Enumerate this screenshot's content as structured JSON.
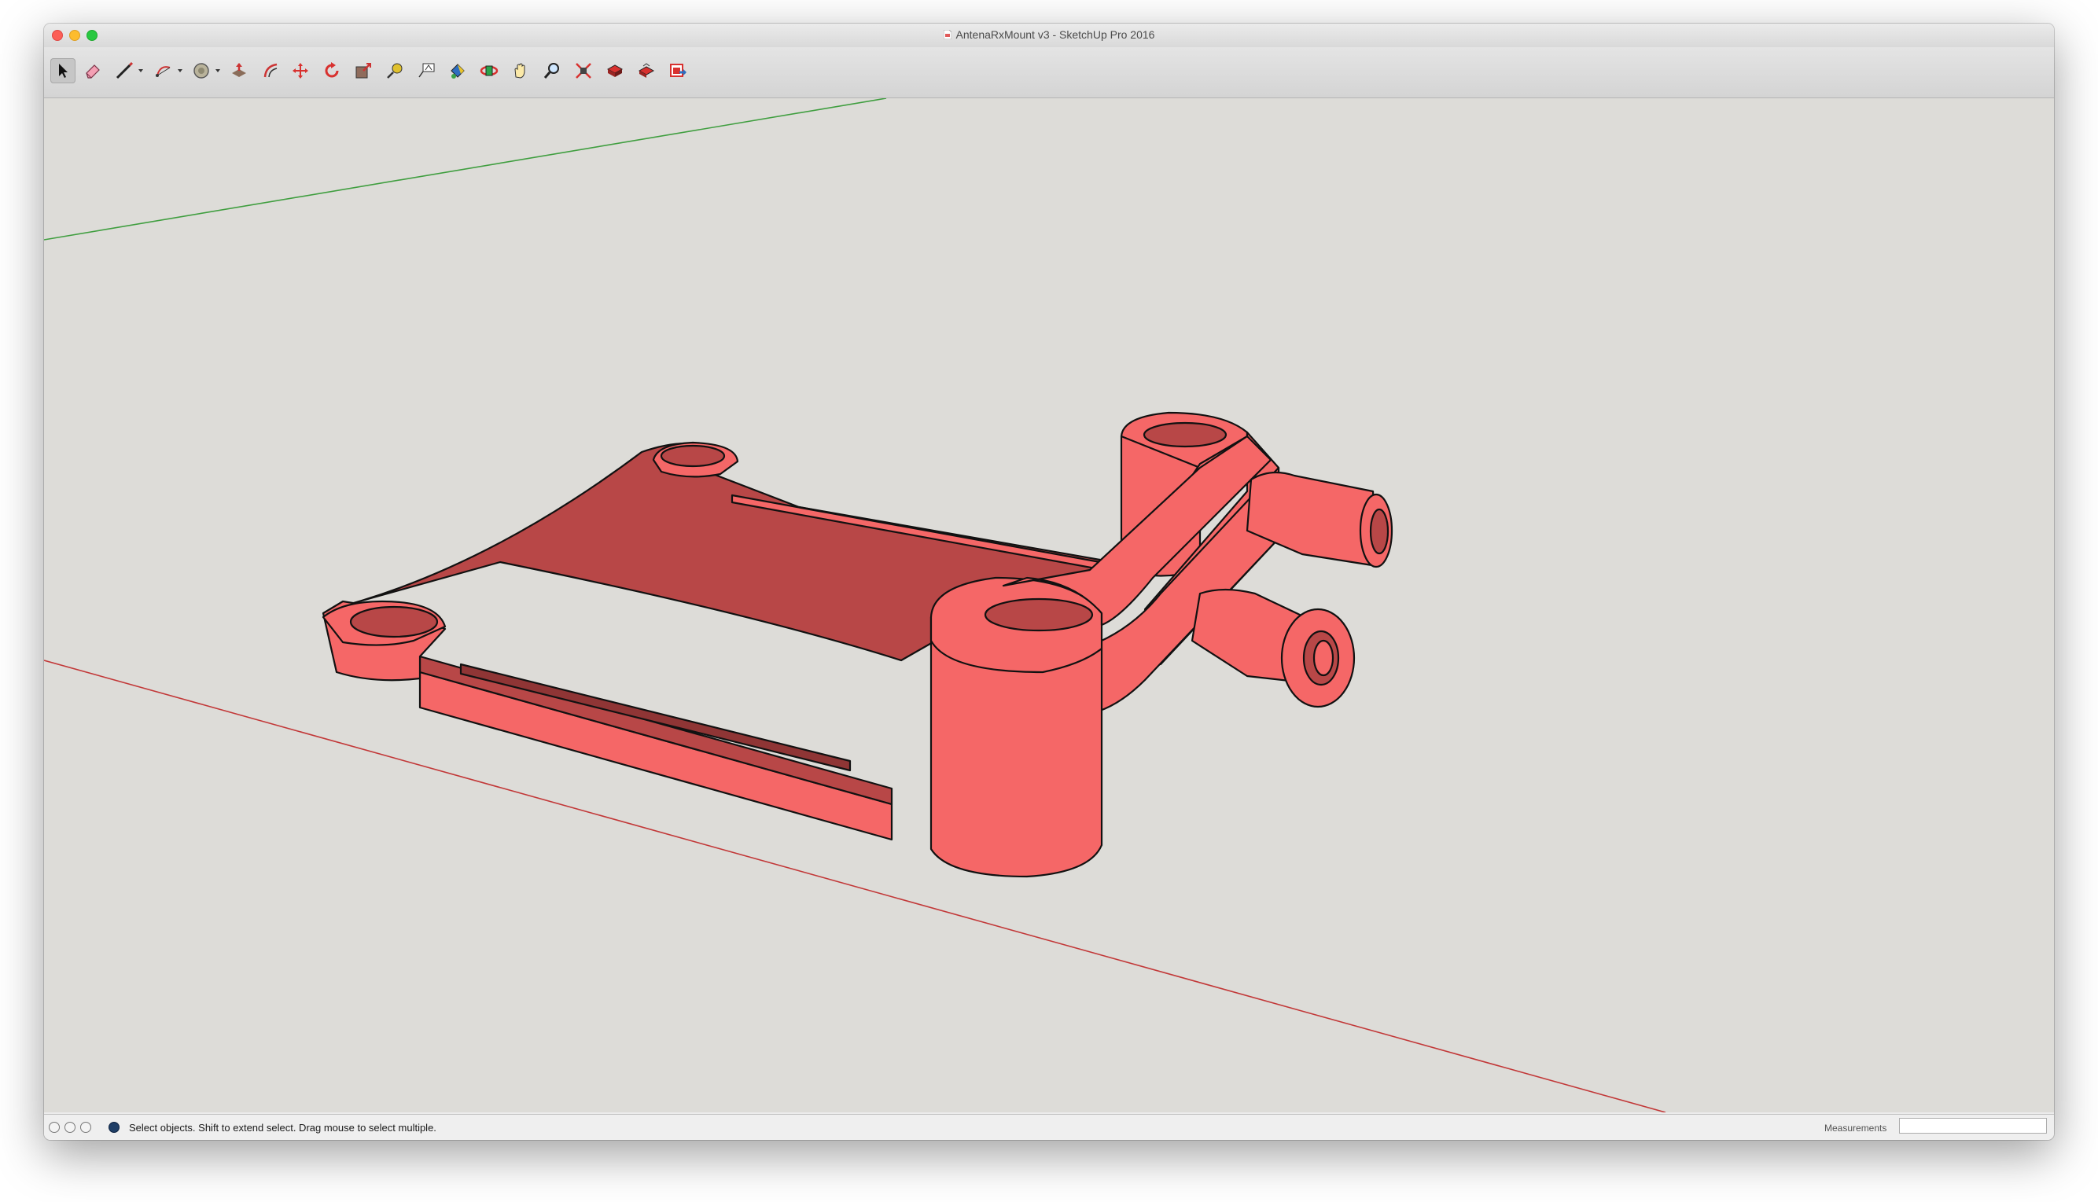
{
  "window": {
    "title": "AntenaRxMount v3 - SketchUp Pro 2016"
  },
  "toolbar": {
    "tools": [
      {
        "name": "select-tool-icon",
        "active": true
      },
      {
        "name": "eraser-tool-icon"
      },
      {
        "name": "line-tool-icon",
        "has_dropdown": true
      },
      {
        "name": "arc-tool-icon",
        "has_dropdown": true
      },
      {
        "name": "shape-tool-icon",
        "has_dropdown": true
      },
      {
        "name": "push-pull-tool-icon"
      },
      {
        "name": "offset-tool-icon"
      },
      {
        "name": "move-tool-icon"
      },
      {
        "name": "rotate-tool-icon"
      },
      {
        "name": "scale-tool-icon"
      },
      {
        "name": "tape-measure-tool-icon"
      },
      {
        "name": "text-tool-icon"
      },
      {
        "name": "paint-bucket-tool-icon"
      },
      {
        "name": "orbit-tool-icon"
      },
      {
        "name": "pan-tool-icon"
      },
      {
        "name": "zoom-tool-icon"
      },
      {
        "name": "zoom-extents-tool-icon"
      },
      {
        "name": "3d-warehouse-icon"
      },
      {
        "name": "extension-warehouse-icon"
      },
      {
        "name": "send-to-layout-icon"
      }
    ]
  },
  "viewport": {
    "background": "#dddcd8",
    "model_color": "#f56767",
    "model_shadow_color": "#b84747",
    "green_axis_color": "#3f9e3f",
    "red_axis_color": "#c23838"
  },
  "statusbar": {
    "status_icons": [
      "geo-location-icon",
      "credits-icon",
      "account-icon",
      "instructor-icon"
    ],
    "message": "Select objects. Shift to extend select. Drag mouse to select multiple.",
    "measurements_label": "Measurements",
    "measurements_value": ""
  }
}
